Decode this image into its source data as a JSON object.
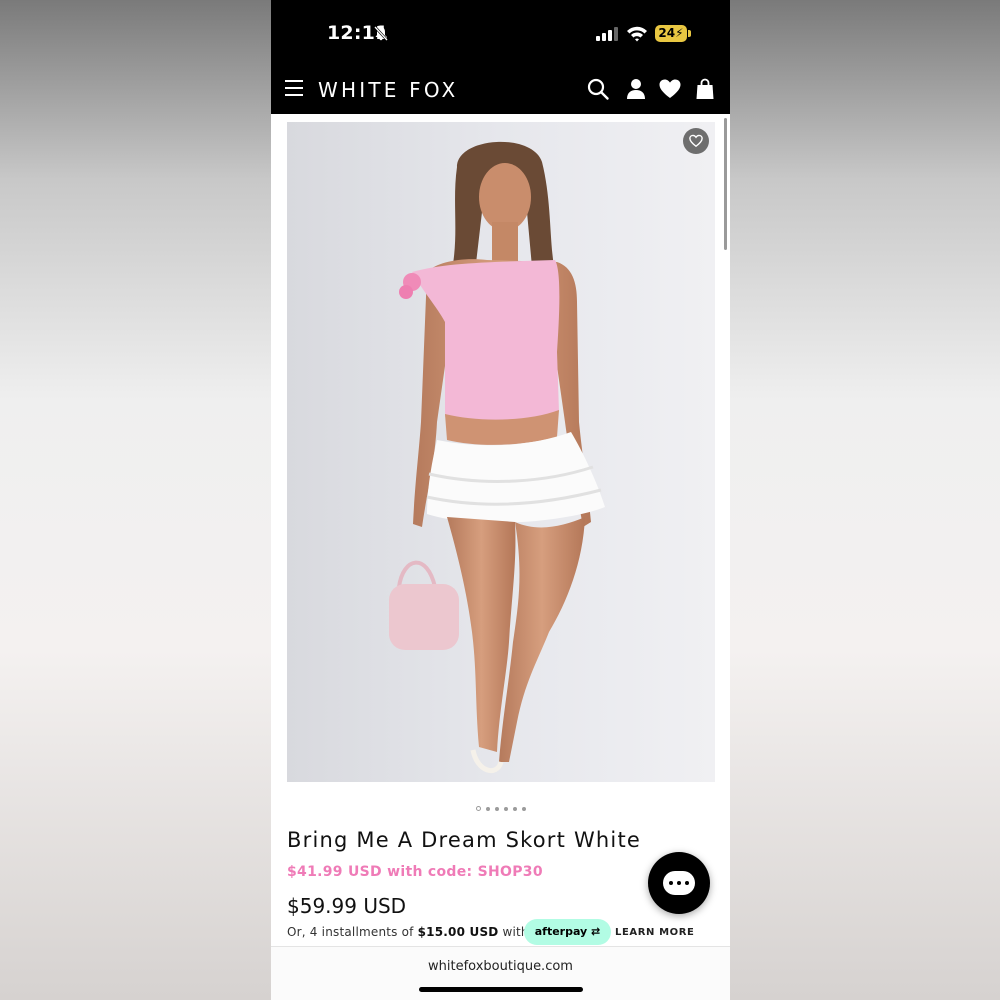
{
  "status_bar": {
    "time": "12:11",
    "battery": "24"
  },
  "header": {
    "brand": "WHITE FOX"
  },
  "product": {
    "title": "Bring Me A Dream Skort White",
    "promo_price": "$41.99 USD with code: SHOP30",
    "price": "$59.99 USD",
    "installments_prefix": "Or, 4 installments of ",
    "installments_amount": "$15.00 USD",
    "installments_suffix": " with",
    "afterpay_label": "afterpay",
    "learn_more": "LEARN MORE",
    "image_count": 6,
    "active_image_index": 0
  },
  "browser": {
    "url": "whitefoxboutique.com"
  },
  "colors": {
    "promo": "#ef7bb7",
    "afterpay_badge": "#b2fce4",
    "header_bg": "#000000",
    "battery": "#e9c742"
  },
  "icons": [
    "bell-slash-icon",
    "signal-icon",
    "wifi-icon",
    "battery-icon",
    "menu-icon",
    "search-icon",
    "account-icon",
    "heart-icon",
    "bag-icon",
    "favorite-heart-icon",
    "chat-icon"
  ]
}
